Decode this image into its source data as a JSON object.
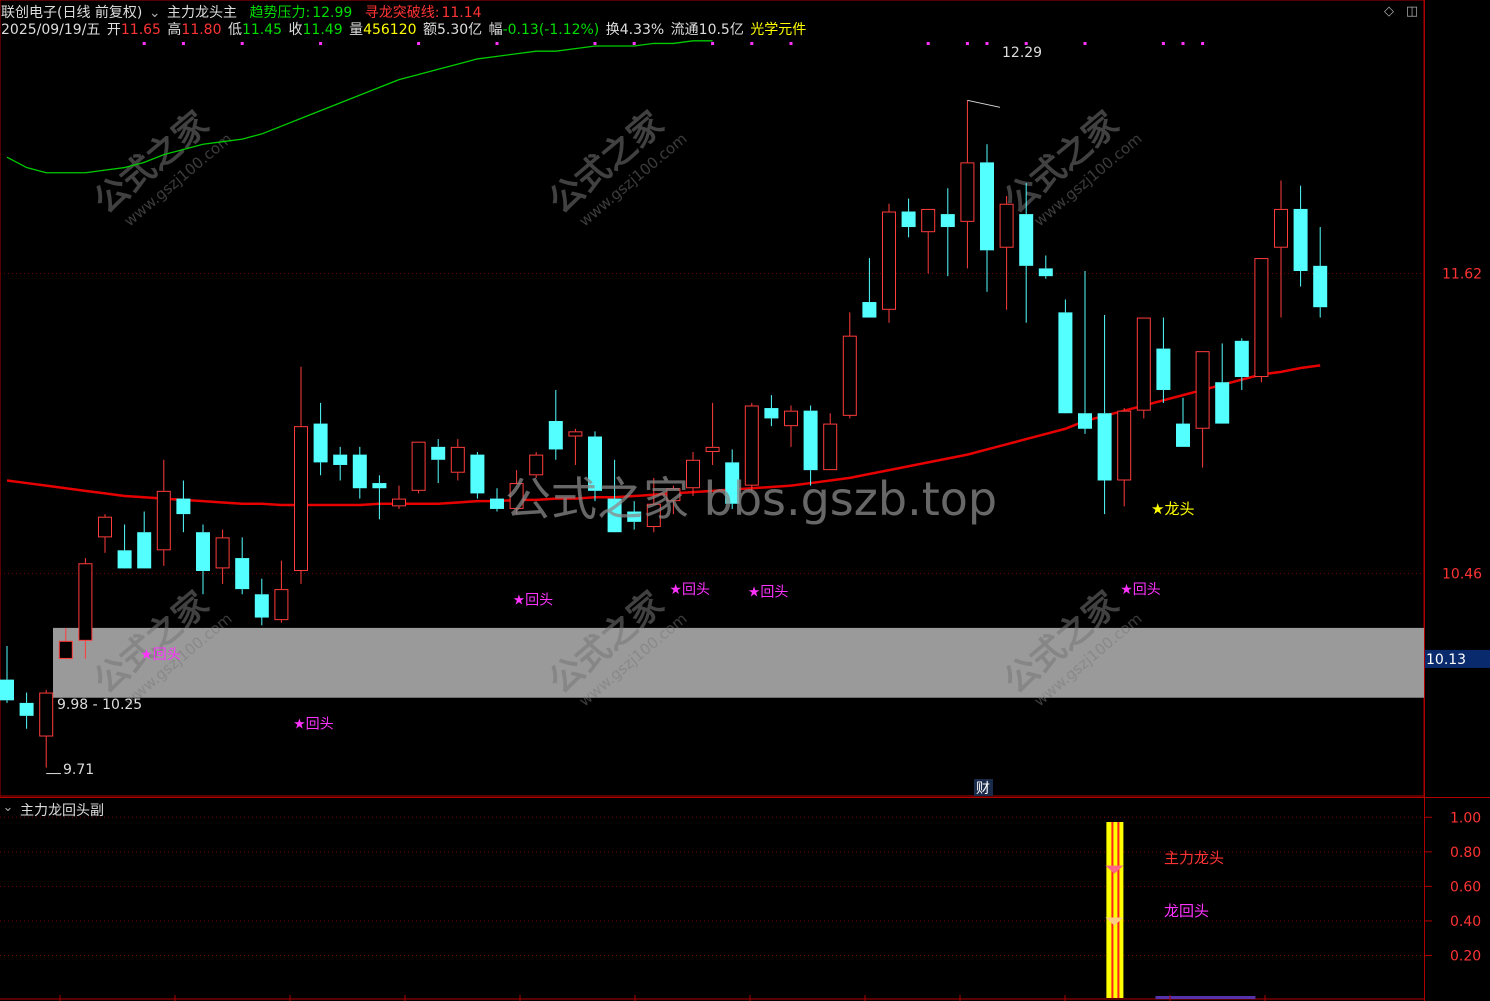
{
  "header": {
    "stock_name": "联创电子(日线 前复权)",
    "indicator_name": "主力龙头主",
    "trend_pressure_label": "趋势压力:",
    "trend_pressure_value": "12.99",
    "breakout_label": "寻龙突破线:",
    "breakout_value": "11.14",
    "date": "2025/09/19/五",
    "open_label": "开",
    "open_value": "11.65",
    "high_label": "高",
    "high_value": "11.80",
    "low_label": "低",
    "low_value": "11.45",
    "close_label": "收",
    "close_value": "11.49",
    "volume_label": "量",
    "volume_value": "456120",
    "amount_label": "额",
    "amount_value": "5.30亿",
    "change_label": "幅",
    "change_value": "-0.13(-1.12%)",
    "turnover_label": "换",
    "turnover_value": "4.33%",
    "float_label": "流通",
    "float_value": "10.5亿",
    "sector": "光学元件"
  },
  "sub_panel": {
    "title": "主力龙回头副",
    "y_ticks": [
      "1.00",
      "0.80",
      "0.60",
      "0.40",
      "0.20"
    ],
    "label_main": "主力龙头",
    "label_return": "龙回头"
  },
  "price_axis": {
    "ticks": [
      "11.62",
      "10.46"
    ],
    "current_price": "10.13"
  },
  "annotations": {
    "high_marker": "12.29",
    "low_marker": "9.71",
    "zone_label": "9.98 - 10.25",
    "dragon_head": "★龙头",
    "return_label": "★回头",
    "finance_badge": "财"
  },
  "watermarks": {
    "main": "公式之家 bbs.gszb.top",
    "small_cn": "公式之家",
    "small_url": "www.gszj100.com"
  },
  "colors": {
    "up_candle": "#ff3c3c",
    "down_candle": "#54ffff",
    "ma_red": "#e60000",
    "ma_green": "#00cc00",
    "zone": "#9a9a9a",
    "magenta": "#ff33ff",
    "yellow": "#ffff00"
  },
  "chart_data": {
    "type": "candlestick",
    "y_scale": {
      "min": 9.6,
      "max": 12.5
    },
    "candles": [
      {
        "o": 10.05,
        "h": 10.18,
        "l": 9.96,
        "c": 9.97
      },
      {
        "o": 9.96,
        "h": 10.0,
        "l": 9.86,
        "c": 9.91
      },
      {
        "o": 9.83,
        "h": 10.01,
        "l": 9.71,
        "c": 10.0
      },
      {
        "o": 10.13,
        "h": 10.25,
        "l": 10.13,
        "c": 10.2
      },
      {
        "o": 10.2,
        "h": 10.52,
        "l": 10.13,
        "c": 10.5
      },
      {
        "o": 10.6,
        "h": 10.69,
        "l": 10.54,
        "c": 10.68
      },
      {
        "o": 10.55,
        "h": 10.65,
        "l": 10.5,
        "c": 10.48
      },
      {
        "o": 10.62,
        "h": 10.7,
        "l": 10.48,
        "c": 10.48
      },
      {
        "o": 10.55,
        "h": 10.9,
        "l": 10.49,
        "c": 10.78
      },
      {
        "o": 10.75,
        "h": 10.82,
        "l": 10.62,
        "c": 10.69
      },
      {
        "o": 10.62,
        "h": 10.65,
        "l": 10.38,
        "c": 10.47
      },
      {
        "o": 10.48,
        "h": 10.63,
        "l": 10.42,
        "c": 10.6
      },
      {
        "o": 10.52,
        "h": 10.6,
        "l": 10.38,
        "c": 10.4
      },
      {
        "o": 10.38,
        "h": 10.44,
        "l": 10.26,
        "c": 10.29
      },
      {
        "o": 10.28,
        "h": 10.51,
        "l": 10.27,
        "c": 10.4
      },
      {
        "o": 10.47,
        "h": 11.26,
        "l": 10.42,
        "c": 11.03
      },
      {
        "o": 11.04,
        "h": 11.12,
        "l": 10.84,
        "c": 10.89
      },
      {
        "o": 10.92,
        "h": 10.95,
        "l": 10.82,
        "c": 10.88
      },
      {
        "o": 10.92,
        "h": 10.95,
        "l": 10.75,
        "c": 10.79
      },
      {
        "o": 10.81,
        "h": 10.84,
        "l": 10.67,
        "c": 10.79
      },
      {
        "o": 10.72,
        "h": 10.8,
        "l": 10.71,
        "c": 10.75
      },
      {
        "o": 10.78,
        "h": 10.96,
        "l": 10.77,
        "c": 10.97
      },
      {
        "o": 10.95,
        "h": 10.98,
        "l": 10.81,
        "c": 10.9
      },
      {
        "o": 10.85,
        "h": 10.98,
        "l": 10.82,
        "c": 10.95
      },
      {
        "o": 10.92,
        "h": 10.93,
        "l": 10.75,
        "c": 10.77
      },
      {
        "o": 10.75,
        "h": 10.79,
        "l": 10.7,
        "c": 10.71
      },
      {
        "o": 10.71,
        "h": 10.86,
        "l": 10.69,
        "c": 10.81
      },
      {
        "o": 10.84,
        "h": 10.93,
        "l": 10.83,
        "c": 10.92
      },
      {
        "o": 11.05,
        "h": 11.17,
        "l": 10.9,
        "c": 10.94
      },
      {
        "o": 10.99,
        "h": 11.02,
        "l": 10.88,
        "c": 11.01
      },
      {
        "o": 10.99,
        "h": 11.01,
        "l": 10.74,
        "c": 10.78
      },
      {
        "o": 10.75,
        "h": 10.9,
        "l": 10.63,
        "c": 10.62
      },
      {
        "o": 10.7,
        "h": 10.74,
        "l": 10.63,
        "c": 10.66
      },
      {
        "o": 10.64,
        "h": 10.83,
        "l": 10.62,
        "c": 10.73
      },
      {
        "o": 10.74,
        "h": 10.8,
        "l": 10.69,
        "c": 10.79
      },
      {
        "o": 10.79,
        "h": 10.93,
        "l": 10.76,
        "c": 10.9
      },
      {
        "o": 10.93,
        "h": 11.12,
        "l": 10.88,
        "c": 10.95
      },
      {
        "o": 10.89,
        "h": 10.94,
        "l": 10.71,
        "c": 10.73
      },
      {
        "o": 10.8,
        "h": 11.12,
        "l": 10.78,
        "c": 11.11
      },
      {
        "o": 11.1,
        "h": 11.15,
        "l": 11.03,
        "c": 11.06
      },
      {
        "o": 11.03,
        "h": 11.11,
        "l": 10.95,
        "c": 11.09
      },
      {
        "o": 11.09,
        "h": 11.11,
        "l": 10.8,
        "c": 10.86
      },
      {
        "o": 10.86,
        "h": 11.08,
        "l": 10.86,
        "c": 11.04
      },
      {
        "o": 11.07,
        "h": 11.47,
        "l": 11.06,
        "c": 11.38
      },
      {
        "o": 11.51,
        "h": 11.68,
        "l": 11.46,
        "c": 11.45
      },
      {
        "o": 11.48,
        "h": 11.89,
        "l": 11.43,
        "c": 11.86
      },
      {
        "o": 11.86,
        "h": 11.91,
        "l": 11.76,
        "c": 11.8
      },
      {
        "o": 11.78,
        "h": 11.86,
        "l": 11.62,
        "c": 11.87
      },
      {
        "o": 11.85,
        "h": 11.95,
        "l": 11.61,
        "c": 11.8
      },
      {
        "o": 11.82,
        "h": 12.29,
        "l": 11.64,
        "c": 12.05
      },
      {
        "o": 12.05,
        "h": 12.12,
        "l": 11.55,
        "c": 11.71
      },
      {
        "o": 11.72,
        "h": 11.92,
        "l": 11.48,
        "c": 11.89
      },
      {
        "o": 11.85,
        "h": 11.97,
        "l": 11.43,
        "c": 11.65
      },
      {
        "o": 11.64,
        "h": 11.69,
        "l": 11.6,
        "c": 11.61
      },
      {
        "o": 11.47,
        "h": 11.52,
        "l": 11.11,
        "c": 11.08
      },
      {
        "o": 11.08,
        "h": 11.63,
        "l": 11.0,
        "c": 11.02
      },
      {
        "o": 11.08,
        "h": 11.46,
        "l": 10.69,
        "c": 10.82
      },
      {
        "o": 10.82,
        "h": 11.1,
        "l": 10.72,
        "c": 11.09
      },
      {
        "o": 11.09,
        "h": 11.44,
        "l": 11.06,
        "c": 11.45
      },
      {
        "o": 11.33,
        "h": 11.45,
        "l": 11.12,
        "c": 11.17
      },
      {
        "o": 11.04,
        "h": 11.14,
        "l": 10.95,
        "c": 10.95
      },
      {
        "o": 11.02,
        "h": 11.3,
        "l": 10.87,
        "c": 11.32
      },
      {
        "o": 11.2,
        "h": 11.35,
        "l": 11.11,
        "c": 11.04
      },
      {
        "o": 11.36,
        "h": 11.37,
        "l": 11.17,
        "c": 11.22
      },
      {
        "o": 11.22,
        "h": 11.66,
        "l": 11.2,
        "c": 11.68
      },
      {
        "o": 11.72,
        "h": 11.98,
        "l": 11.45,
        "c": 11.87
      },
      {
        "o": 11.87,
        "h": 11.96,
        "l": 11.57,
        "c": 11.63
      },
      {
        "o": 11.65,
        "h": 11.8,
        "l": 11.45,
        "c": 11.49
      }
    ],
    "ma_red": [
      10.82,
      10.81,
      10.8,
      10.79,
      10.78,
      10.77,
      10.76,
      10.755,
      10.75,
      10.745,
      10.74,
      10.735,
      10.73,
      10.73,
      10.725,
      10.725,
      10.725,
      10.725,
      10.725,
      10.73,
      10.73,
      10.73,
      10.73,
      10.735,
      10.74,
      10.74,
      10.745,
      10.745,
      10.75,
      10.75,
      10.755,
      10.755,
      10.76,
      10.765,
      10.77,
      10.775,
      10.78,
      10.785,
      10.79,
      10.795,
      10.8,
      10.81,
      10.82,
      10.83,
      10.845,
      10.86,
      10.875,
      10.89,
      10.905,
      10.92,
      10.94,
      10.96,
      10.98,
      11.0,
      11.02,
      11.05,
      11.07,
      11.09,
      11.11,
      11.13,
      11.15,
      11.17,
      11.19,
      11.21,
      11.23,
      11.24,
      11.255,
      11.265
    ],
    "ma_green": [
      12.07,
      12.03,
      12.01,
      12.01,
      12.01,
      12.02,
      12.03,
      12.05,
      12.08,
      12.1,
      12.12,
      12.13,
      12.14,
      12.16,
      12.19,
      12.22,
      12.25,
      12.28,
      12.31,
      12.34,
      12.37,
      12.39,
      12.41,
      12.43,
      12.45,
      12.46,
      12.47,
      12.48,
      12.48,
      12.49,
      12.5,
      12.5,
      12.5,
      12.51,
      12.51,
      12.52,
      12.52
    ],
    "zone": {
      "low": 9.98,
      "high": 10.25,
      "label": "9.98 - 10.25"
    },
    "current_price": 10.13,
    "top_markers_idx": [
      7,
      9,
      12,
      16,
      21,
      25,
      30,
      32,
      36,
      38,
      40,
      47,
      49,
      50,
      52,
      55,
      59,
      60,
      61
    ],
    "return_markers": [
      {
        "idx": 7,
        "price": 10.15
      },
      {
        "idx": 14.8,
        "price": 9.88
      },
      {
        "idx": 26,
        "price": 10.36
      },
      {
        "idx": 34,
        "price": 10.4
      },
      {
        "idx": 38,
        "price": 10.39
      },
      {
        "idx": 57,
        "price": 10.4
      }
    ],
    "dragon_head": {
      "idx": 57,
      "price": 10.62
    },
    "sub_signal_idx": 56.5,
    "sub_scale": {
      "min": 0.0,
      "max": 1.1
    }
  }
}
